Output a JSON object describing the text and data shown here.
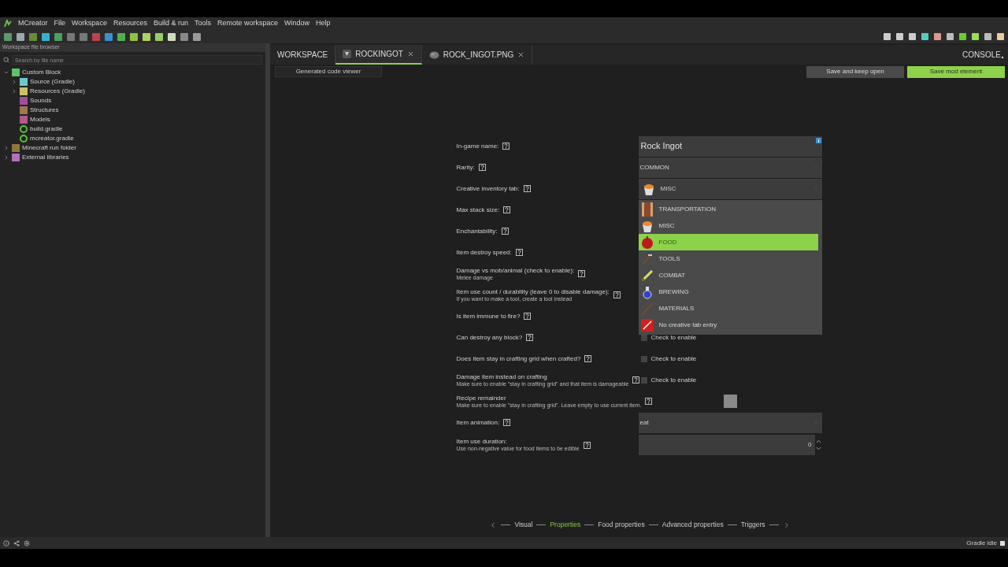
{
  "menu": [
    "MCreator",
    "File",
    "Workspace",
    "Resources",
    "Build & run",
    "Tools",
    "Remote workspace",
    "Window",
    "Help"
  ],
  "sidebar": {
    "title": "Workspace file browser",
    "search": {
      "placeholder": "Search by file name"
    },
    "tree": [
      {
        "label": "Custom Block",
        "kind": "project",
        "expanded": true,
        "children": [
          {
            "label": "Source (Gradle)",
            "kind": "source",
            "expanded": false
          },
          {
            "label": "Resources (Gradle)",
            "kind": "resources",
            "expanded": false
          },
          {
            "label": "Sounds",
            "kind": "sounds"
          },
          {
            "label": "Structures",
            "kind": "structures"
          },
          {
            "label": "Models",
            "kind": "models"
          },
          {
            "label": "build.gradle",
            "kind": "gradle"
          },
          {
            "label": "mcreator.gradle",
            "kind": "gradle"
          }
        ]
      },
      {
        "label": "Minecraft run folder",
        "kind": "run-folder",
        "expanded": false
      },
      {
        "label": "External libraries",
        "kind": "libraries",
        "expanded": false
      }
    ]
  },
  "tabs": [
    {
      "label": "WORKSPACE",
      "kind": "plain",
      "selected": false
    },
    {
      "label": "ROCKINGOT",
      "kind": "element",
      "selected": true
    },
    {
      "label": "ROCK_INGOT.PNG",
      "kind": "texture",
      "selected": false
    }
  ],
  "console": "CONSOLE",
  "code_viewer_button": "Generated code viewer",
  "buttons": [
    {
      "label": "Save and keep open",
      "kind": "secondary"
    },
    {
      "label": "Save mod element",
      "kind": "primary"
    }
  ],
  "form": [
    {
      "label": "In-game name:",
      "kind": "text",
      "value": "Rock Ingot"
    },
    {
      "label": "Rarity:",
      "kind": "combo",
      "value": "COMMON"
    },
    {
      "label": "Creative inventory tab:",
      "kind": "combo-icon",
      "value": "MISC"
    },
    {
      "label": "Max stack size:",
      "kind": "covered"
    },
    {
      "label": "Enchantability:",
      "kind": "covered"
    },
    {
      "label": "Item destroy speed:",
      "kind": "covered"
    },
    {
      "label": "Damage vs mob/animal (check to enable):",
      "hint": "Melee damage",
      "kind": "covered"
    },
    {
      "label": "Item use count / durability (leave 0 to disable damage):",
      "hint": "If you want to make a tool, create a tool instead",
      "kind": "covered"
    },
    {
      "label": "Is item immune to fire?",
      "kind": "covered"
    },
    {
      "label": "Can destroy any block?",
      "kind": "checkbox",
      "value": "Check to enable",
      "checked": false
    },
    {
      "label": "Does item stay in crafting grid when crafted?",
      "kind": "checkbox",
      "value": "Check to enable",
      "checked": false
    },
    {
      "label": "Damage item instead on crafting",
      "hint": "Make sure to enable \"stay in crafting grid\" and that item is damageable",
      "kind": "checkbox",
      "value": "Check to enable",
      "checked": false
    },
    {
      "label": "Recipe remainder",
      "hint": "Make sure to enable \"stay in crafting grid\". Leave empty to use current item.",
      "kind": "slot"
    },
    {
      "label": "Item animation:",
      "kind": "combo",
      "value": "eat"
    },
    {
      "label": "Item use duration:",
      "hint": "Use non-negative value for food items to be edible",
      "kind": "spinner",
      "value": "0"
    }
  ],
  "dropdown": {
    "items": [
      {
        "label": "TRANSPORTATION",
        "kind": "transportation",
        "selected": false
      },
      {
        "label": "MISC",
        "kind": "misc",
        "selected": false
      },
      {
        "label": "FOOD",
        "kind": "food",
        "selected": true
      },
      {
        "label": "TOOLS",
        "kind": "tools",
        "selected": false
      },
      {
        "label": "COMBAT",
        "kind": "combat",
        "selected": false
      },
      {
        "label": "BREWING",
        "kind": "brewing",
        "selected": false
      },
      {
        "label": "MATERIALS",
        "kind": "materials",
        "selected": false
      },
      {
        "label": "No creative tab entry",
        "kind": "none",
        "selected": false
      }
    ]
  },
  "steps": [
    {
      "label": "Visual",
      "selected": false
    },
    {
      "label": "Properties",
      "selected": true
    },
    {
      "label": "Food properties",
      "selected": false
    },
    {
      "label": "Advanced properties",
      "selected": false
    },
    {
      "label": "Triggers",
      "selected": false
    }
  ],
  "status": "Gradle idle"
}
